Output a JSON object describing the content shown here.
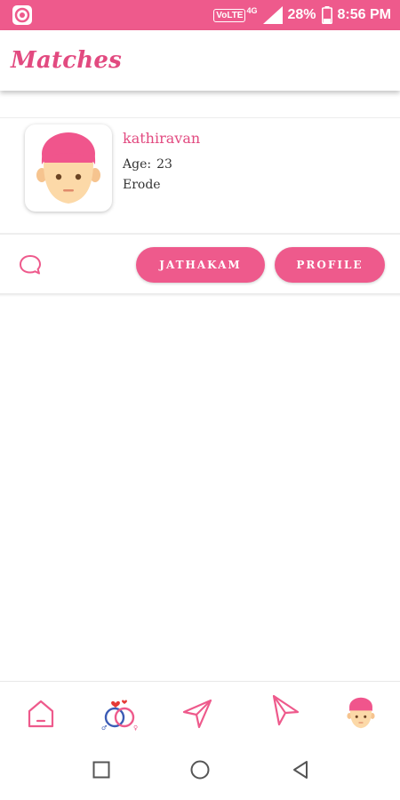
{
  "status_bar": {
    "network_badge": "VoLTE",
    "network_type": "4G",
    "battery": "28%",
    "time": "8:56 PM"
  },
  "app_bar": {
    "title": "Matches"
  },
  "match": {
    "name": "kathiravan",
    "age_label": "Age:",
    "age_value": "23",
    "city": "Erode",
    "jathakam_button": "JATHAKAM",
    "profile_button": "PROFILE"
  },
  "bottom_nav": {
    "icons": [
      "home-icon",
      "matches-rings-icon",
      "send-icon",
      "sent-requests-icon",
      "profile-avatar-icon"
    ]
  },
  "colors": {
    "accent": "#ee5a8c",
    "title": "#e24a80",
    "skin": "#fcd9a8",
    "hair": "#f0558c"
  }
}
